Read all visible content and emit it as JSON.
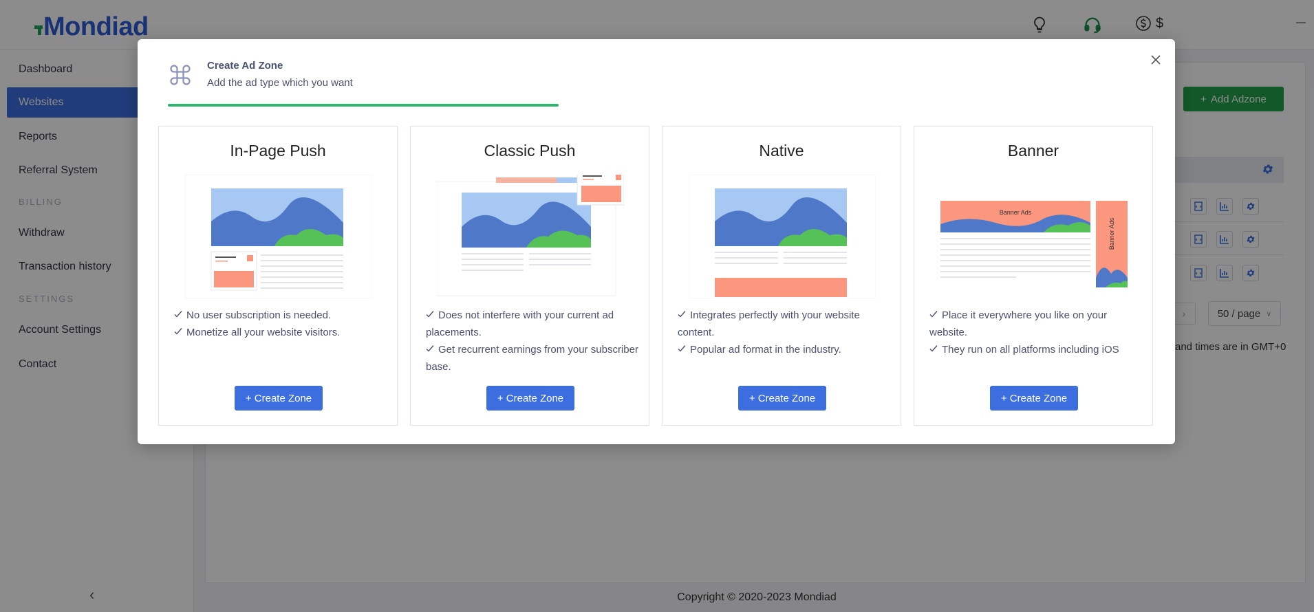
{
  "brand": {
    "name": "Mondiad"
  },
  "topbar": {
    "balance_symbol": "$"
  },
  "sidebar": {
    "items": [
      {
        "label": "Dashboard"
      },
      {
        "label": "Websites"
      },
      {
        "label": "Reports"
      },
      {
        "label": "Referral System"
      }
    ],
    "billing_label": "BILLING",
    "billing_items": [
      {
        "label": "Withdraw"
      },
      {
        "label": "Transaction history"
      }
    ],
    "settings_label": "SETTINGS",
    "settings_items": [
      {
        "label": "Account Settings"
      },
      {
        "label": "Contact"
      }
    ]
  },
  "main": {
    "add_adzone_label": "Add Adzone",
    "per_page": "50 / page",
    "timezone_note": "and times are in GMT+0"
  },
  "footer": {
    "copyright": "Copyright © 2020-2023 Mondiad"
  },
  "modal": {
    "title": "Create Ad Zone",
    "subtitle": "Add the ad type which you want",
    "progress": 0.4,
    "progress_color": "#2eb86e",
    "cards": [
      {
        "title": "In-Page Push",
        "features": [
          "No user subscription is needed.",
          "Monetize all your website visitors."
        ],
        "button": "+ Create Zone"
      },
      {
        "title": "Classic Push",
        "features": [
          "Does not interfere with your current ad placements.",
          "Get recurrent earnings from your subscriber base."
        ],
        "button": "+ Create Zone"
      },
      {
        "title": "Native",
        "features": [
          "Integrates perfectly with your website content.",
          "Popular ad format in the industry."
        ],
        "button": "+ Create Zone"
      },
      {
        "title": "Banner",
        "features": [
          "Place it everywhere you like on your website.",
          "They run on all platforms including iOS"
        ],
        "button": "+ Create Zone",
        "illustration_text": "Banner Ads"
      }
    ]
  },
  "colors": {
    "primary": "#3c6ee0",
    "success": "#21a04a",
    "salmon": "#fb977f",
    "sky": "#9fc3f3",
    "mountain": "#4f79c8",
    "bush": "#56c157"
  }
}
